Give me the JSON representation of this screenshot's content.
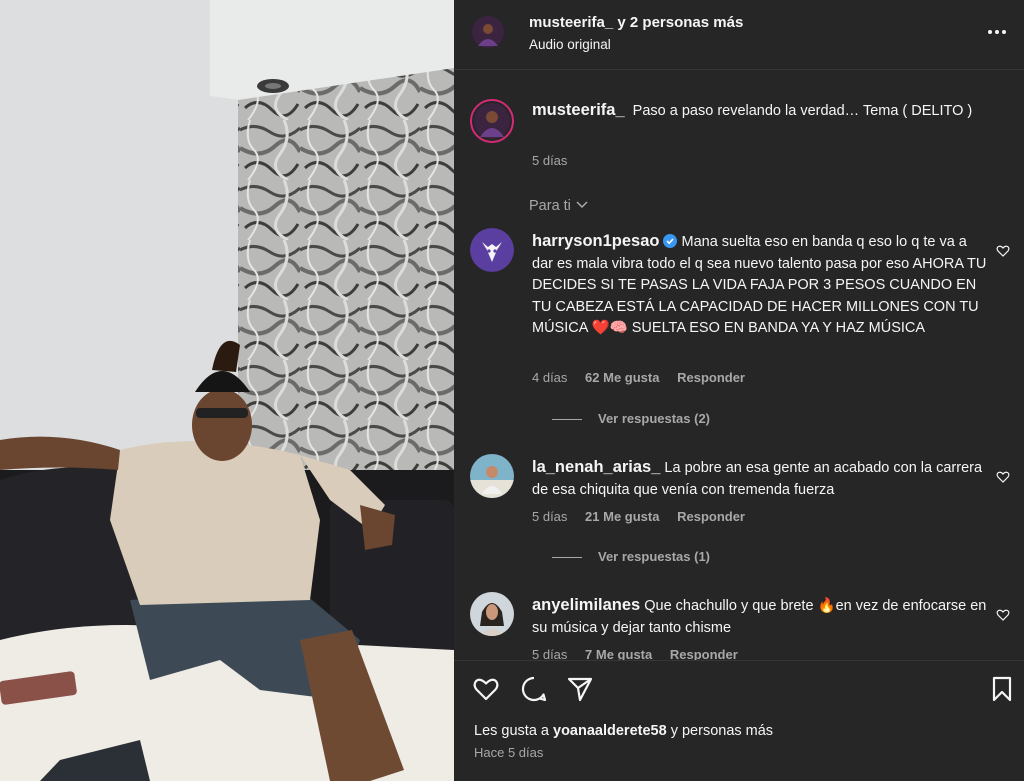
{
  "header": {
    "username": "musteerifa_",
    "others": "y 2 personas más",
    "audio": "Audio original"
  },
  "caption": {
    "username": "musteerifa_",
    "text": "Paso a paso revelando la verdad… Tema ( DELITO )",
    "time": "5 días"
  },
  "sort_label": "Para ti",
  "comments": [
    {
      "username": "harryson1pesao",
      "verified": true,
      "text": "Mana suelta eso en banda q eso lo q te va a dar es mala vibra todo el q sea nuevo talento pasa por eso AHORA TU DECIDES SI TE PASAS LA VIDA FAJA POR 3 PESOS CUANDO EN TU CABEZA ESTÁ LA CAPACIDAD DE HACER MILLONES CON TU MÚSICA ❤️🧠 SUELTA ESO EN BANDA YA Y HAZ MÚSICA",
      "time": "4 días",
      "likes": "62 Me gusta",
      "reply": "Responder",
      "view_replies": "Ver respuestas (2)"
    },
    {
      "username": "la_nenah_arias_",
      "verified": false,
      "text": "La pobre an esa gente an acabado con la carrera de esa chiquita que venía con tremenda fuerza",
      "time": "5 días",
      "likes": "21 Me gusta",
      "reply": "Responder",
      "view_replies": "Ver respuestas (1)"
    },
    {
      "username": "anyelimilanes",
      "verified": false,
      "text": "Que chachullo y que brete 🔥en vez de enfocarse en su música y dejar tanto chisme",
      "time": "5 días",
      "likes": "7 Me gusta",
      "reply": "Responder"
    }
  ],
  "footer": {
    "liked_by_prefix": "Les gusta a",
    "liked_by_user": "yoanaalderete58",
    "liked_by_suffix": "y personas más",
    "posted": "Hace 5 días"
  },
  "icons": {
    "like": "heart-icon",
    "comment": "comment-icon",
    "share": "share-icon",
    "save": "bookmark-icon",
    "more": "more-options-icon"
  },
  "colors": {
    "panel_bg": "#262626",
    "text_primary": "#f5f5f5",
    "text_secondary": "#a8a8a8",
    "verified": "#3897f0",
    "story_ring": "#d62976"
  }
}
